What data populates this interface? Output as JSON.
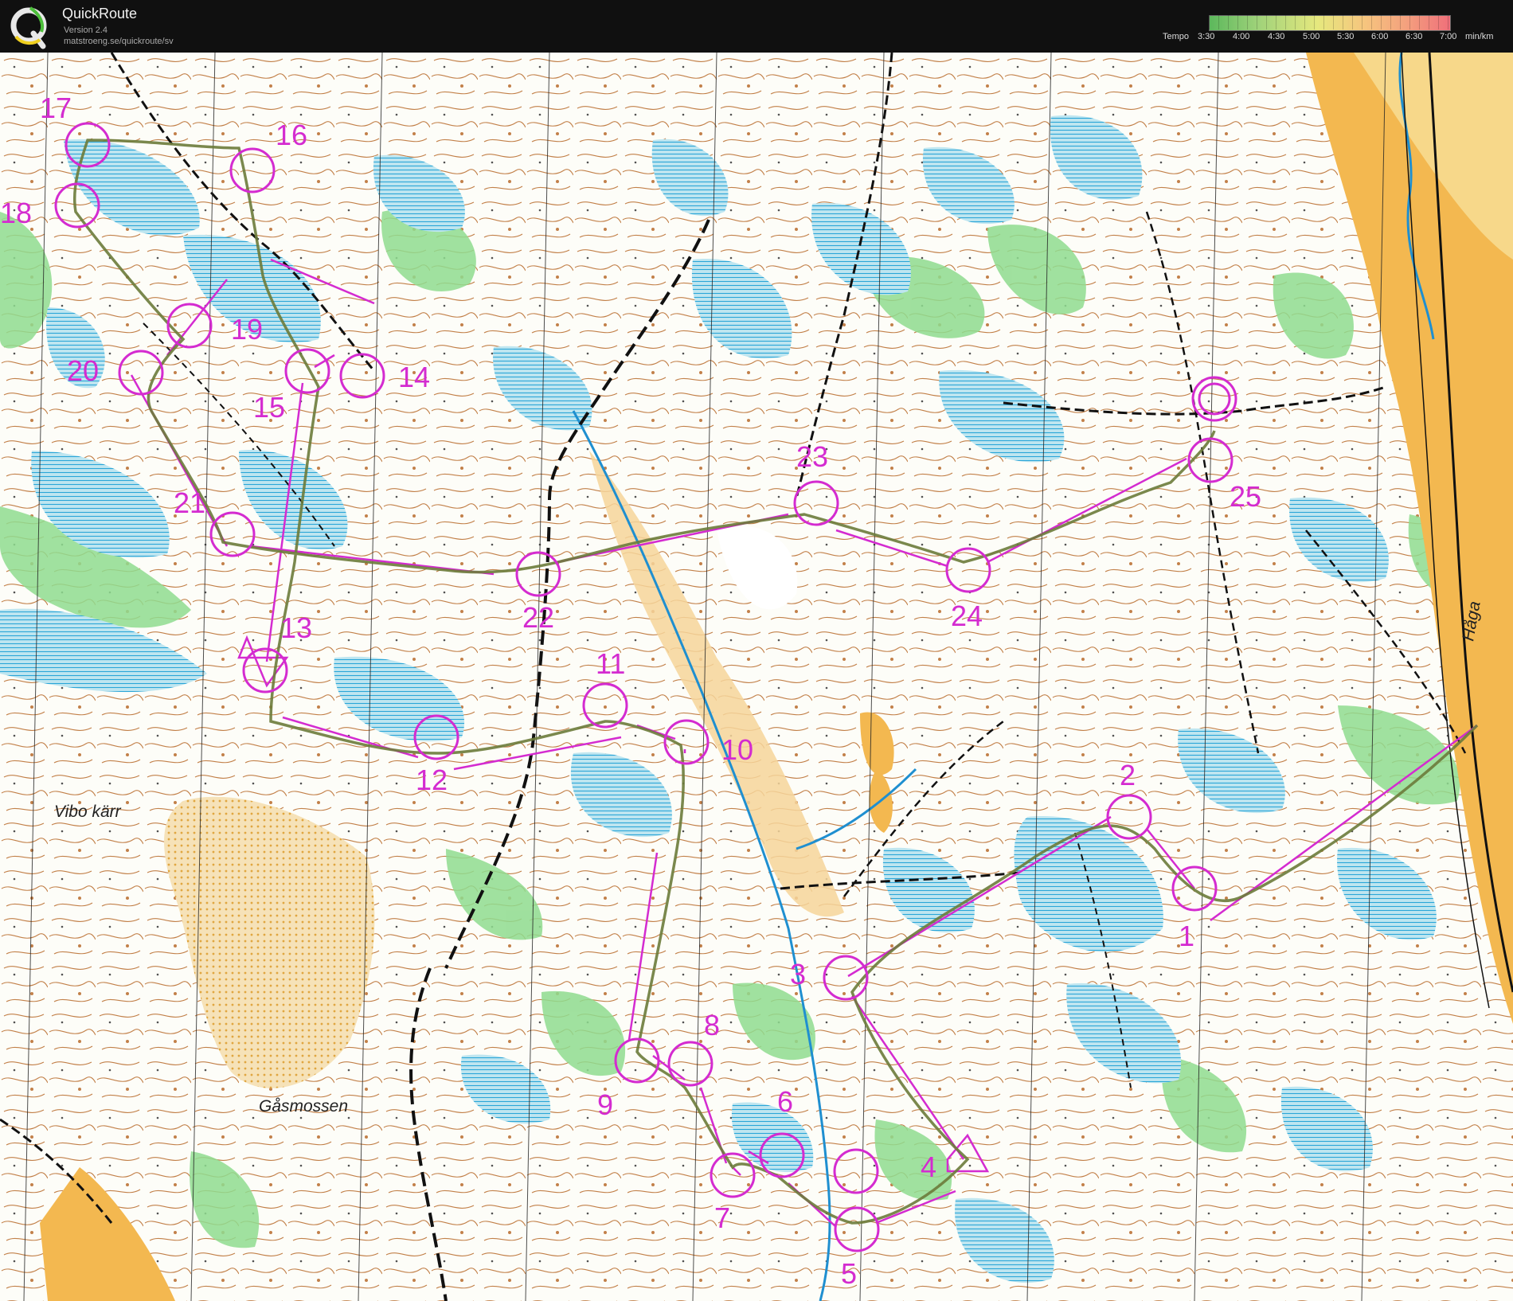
{
  "app": {
    "title": "QuickRoute",
    "version": "Version 2.4",
    "url": "matstroeng.se/quickroute/sv"
  },
  "legend": {
    "label": "Tempo",
    "ticks": [
      "3:30",
      "4:00",
      "4:30",
      "5:00",
      "5:30",
      "6:00",
      "6:30",
      "7:00"
    ],
    "unit": "min/km",
    "gradient_colors": [
      "#5cb85c",
      "#e6e87e",
      "#ef6f7a"
    ]
  },
  "map": {
    "place_names": [
      "Vibo kärr",
      "Gåsmossen",
      "Håga"
    ],
    "control_numbers": [
      "1",
      "2",
      "3",
      "4",
      "5",
      "6",
      "7",
      "8",
      "9",
      "10",
      "11",
      "12",
      "13",
      "14",
      "15",
      "16",
      "17",
      "18",
      "19",
      "20",
      "21",
      "22",
      "23",
      "24",
      "25"
    ],
    "colors": {
      "course": "#d42bd0",
      "route": "#6b7b3a",
      "marsh": "#35b0e0",
      "vegetation": "#8fdc8f",
      "open_land": "#f3b850",
      "contour": "#b86a2a",
      "paper": "#fdfdf8"
    }
  }
}
